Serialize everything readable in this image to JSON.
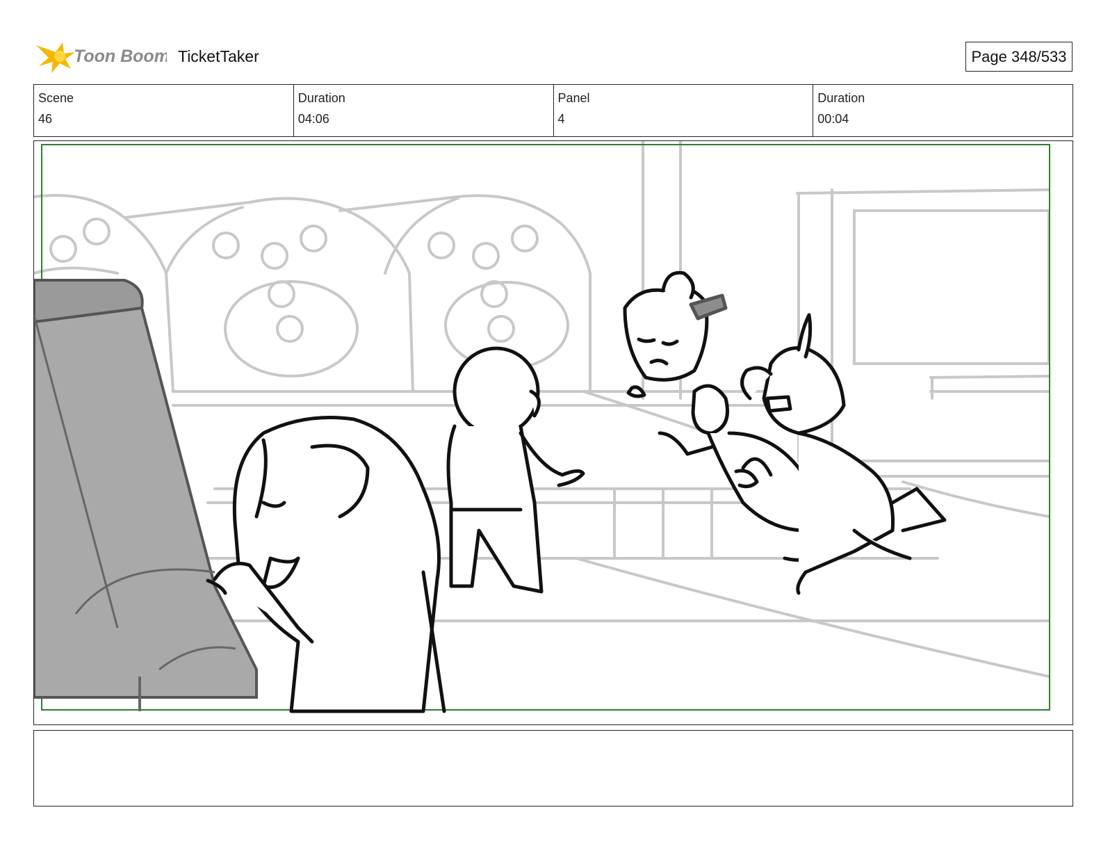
{
  "header": {
    "logo_text": "Toon Boom",
    "project_title": "TicketTaker",
    "page_indicator": "Page 348/533"
  },
  "info": {
    "scene_label": "Scene",
    "scene_value": "46",
    "scene_duration_label": "Duration",
    "scene_duration_value": "04:06",
    "panel_label": "Panel",
    "panel_value": "4",
    "panel_duration_label": "Duration",
    "panel_duration_value": "00:04"
  },
  "notes": {
    "text": ""
  },
  "colors": {
    "safe_frame": "#2e7d32",
    "logo_star": "#f5b800",
    "logo_text": "#888888",
    "sketch_light": "#c8c8c8",
    "sketch_dark": "#111111",
    "seat_fill": "#a9a9a9"
  }
}
